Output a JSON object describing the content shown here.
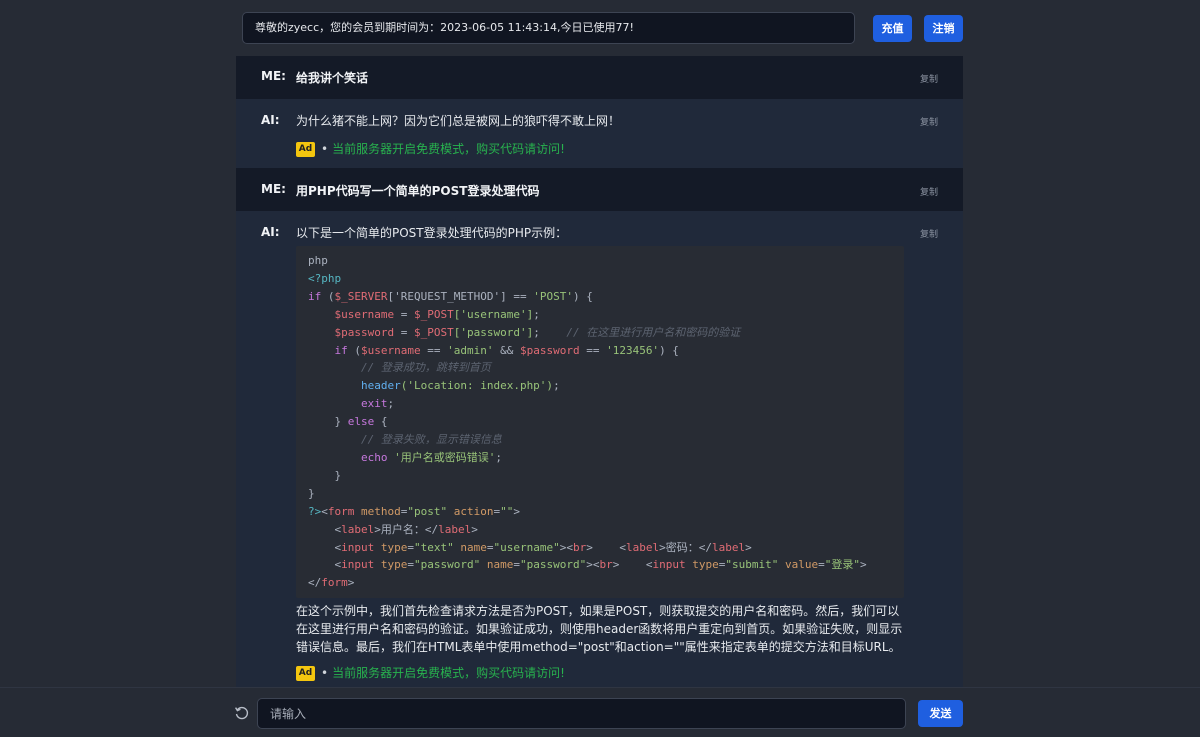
{
  "header": {
    "notice": "尊敬的zyecc，您的会员到期时间为：2023-06-05 11:43:14,今日已使用77!",
    "recharge_label": "充值",
    "logout_label": "注销"
  },
  "messages": [
    {
      "role": "ME:",
      "text": "给我讲个笑话",
      "copy": "复制"
    },
    {
      "role": "AI:",
      "text": "为什么猪不能上网？因为它们总是被网上的狼吓得不敢上网！",
      "copy": "复制",
      "ad": {
        "badge": "Ad",
        "bullet": "•",
        "text": "当前服务器开启免费模式，购买代码请访问!"
      }
    },
    {
      "role": "ME:",
      "text": "用PHP代码写一个简单的POST登录处理代码",
      "copy": "复制"
    },
    {
      "role": "AI:",
      "intro": "以下是一个简单的POST登录处理代码的PHP示例：",
      "copy": "复制",
      "code_lang": "php",
      "outro": "在这个示例中，我们首先检查请求方法是否为POST，如果是POST，则获取提交的用户名和密码。然后，我们可以在这里进行用户名和密码的验证。如果验证成功，则使用header函数将用户重定向到首页。如果验证失败，则显示错误信息。最后，我们在HTML表单中使用method=\"post\"和action=\"\"属性来指定表单的提交方法和目标URL。",
      "ad": {
        "badge": "Ad",
        "bullet": "•",
        "text": "当前服务器开启免费模式，购买代码请访问!"
      }
    }
  ],
  "code": {
    "l1": "<?php",
    "l2a": "if",
    "l2b": " (",
    "l2c": "$_SERVER",
    "l2d": "['REQUEST_METHOD']",
    "l2e": " == ",
    "l2f": "'POST'",
    "l2g": ") {",
    "l3a": "$username",
    "l3b": " = ",
    "l3c": "$_POST",
    "l3d": "['username']",
    "l3e": ";",
    "l4a": "$password",
    "l4b": " = ",
    "l4c": "$_POST",
    "l4d": "['password']",
    "l4e": ";",
    "l4f": "// 在这里进行用户名和密码的验证",
    "l5a": "if",
    "l5b": " (",
    "l5c": "$username",
    "l5d": " == ",
    "l5e": "'admin'",
    "l5f": " && ",
    "l5g": "$password",
    "l5h": " == ",
    "l5i": "'123456'",
    "l5j": ") {",
    "l6": "// 登录成功，跳转到首页",
    "l7a": "header",
    "l7b": "('Location: index.php')",
    "l7c": ";",
    "l8a": "exit",
    "l8b": ";",
    "l9a": "} ",
    "l9b": "else",
    "l9c": " {",
    "l10": "// 登录失败，显示错误信息",
    "l11a": "echo",
    "l11b": " '用户名或密码错误'",
    "l11c": ";",
    "l12": "}",
    "l13": "}",
    "l14a": "?>",
    "l14b": "<",
    "l14c": "form",
    "l14d": " method",
    "l14e": "=",
    "l14f": "\"post\"",
    "l14g": " action",
    "l14h": "=",
    "l14i": "\"\"",
    "l14j": ">",
    "l15a": "<",
    "l15b": "label",
    "l15c": ">用户名：</",
    "l15d": "label",
    "l15e": ">",
    "l16a": "<",
    "l16b": "input",
    "l16c": " type",
    "l16d": "=",
    "l16e": "\"text\"",
    "l16f": " name",
    "l16g": "=",
    "l16h": "\"username\"",
    "l16i": "><",
    "l16j": "br",
    "l16k": ">",
    "l16l": "<",
    "l16m": "label",
    "l16n": ">密码：</",
    "l16o": "label",
    "l16p": ">",
    "l17a": "<",
    "l17b": "input",
    "l17c": " type",
    "l17d": "=",
    "l17e": "\"password\"",
    "l17f": " name",
    "l17g": "=",
    "l17h": "\"password\"",
    "l17i": "><",
    "l17j": "br",
    "l17k": ">",
    "l17l": "<",
    "l17m": "input",
    "l17n": " type",
    "l17o": "=",
    "l17p": "\"submit\"",
    "l17q": " value",
    "l17r": "=",
    "l17s": "\"登录\"",
    "l17t": ">",
    "l18a": "</",
    "l18b": "form",
    "l18c": ">"
  },
  "footer": {
    "placeholder": "请输入",
    "send_label": "发送",
    "reset_icon": "refresh-icon"
  }
}
